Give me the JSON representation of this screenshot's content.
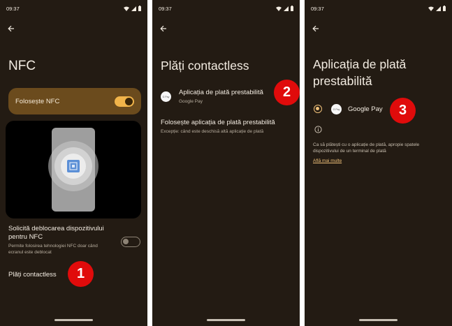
{
  "status_bar": {
    "time": "09:37"
  },
  "screen1": {
    "title": "NFC",
    "nfc_toggle": {
      "label": "Folosește NFC",
      "on": true
    },
    "unlock_setting": {
      "title": "Solicită deblocarea dispozitivului pentru NFC",
      "subtitle": "Permite folosirea tehnologiei NFC doar când ecranul este deblocat",
      "on": false
    },
    "contactless_item": "Plăți contactless",
    "step": "1"
  },
  "screen2": {
    "title": "Plăți contactless",
    "default_app_item": {
      "title": "Aplicația de plată prestabilită",
      "subtitle": "Google Pay",
      "icon": "google-pay-icon"
    },
    "open_app_item": {
      "title": "Folosește aplicația de plată prestabilită",
      "subtitle": "Excepție: când este deschisă altă aplicație de plată"
    },
    "step": "2"
  },
  "screen3": {
    "title": "Aplicația de plată prestabilită",
    "option": {
      "label": "Google Pay",
      "selected": true,
      "icon": "google-pay-icon"
    },
    "info_text": "Ca să plătești cu o aplicație de plată, apropie spatele dispozitivului de un terminal de plată",
    "learn_more": "Află mai multe",
    "step": "3"
  },
  "colors": {
    "background": "#231b13",
    "accent": "#f1b44a",
    "card": "#6b4b1d",
    "step_badge": "#e00b0b"
  }
}
